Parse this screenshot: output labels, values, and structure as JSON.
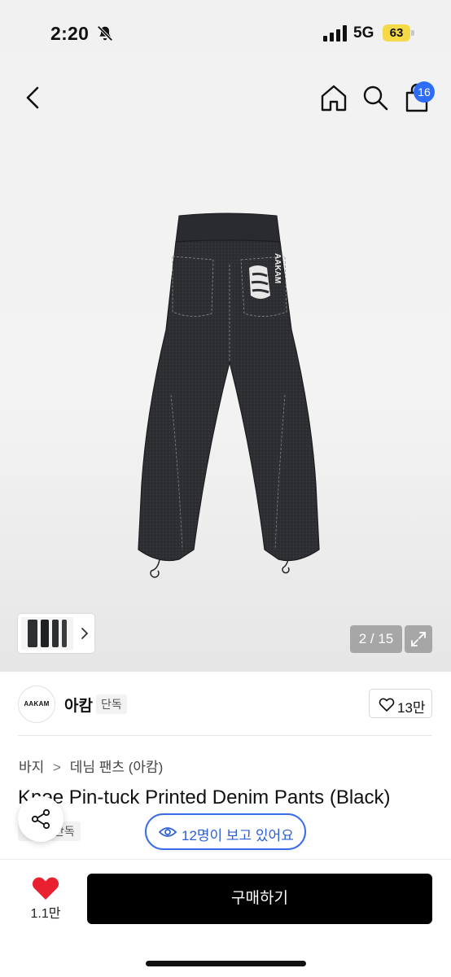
{
  "status_bar": {
    "time": "2:20",
    "network": "5G",
    "battery": "63"
  },
  "nav": {
    "cart_count": "16"
  },
  "gallery": {
    "counter": "2 / 15"
  },
  "brand": {
    "logo_text": "AAKAM",
    "name": "아캄",
    "tag": "단독",
    "likes": "13만"
  },
  "breadcrumb": [
    "바지",
    ">",
    "데님 팬츠 (아캄)"
  ],
  "product": {
    "title": "Knee Pin-tuck Printed Denim Pants (Black)",
    "exclusive_tag": "단독",
    "viewers": "12명이 보고 있어요",
    "print_text": "AAKAM"
  },
  "bottom": {
    "fav_count": "1.1만",
    "buy_label": "구매하기"
  },
  "colors": {
    "accent_blue": "#2f6cf6",
    "heart_red": "#e8202f",
    "denim": "#2e2f33"
  }
}
